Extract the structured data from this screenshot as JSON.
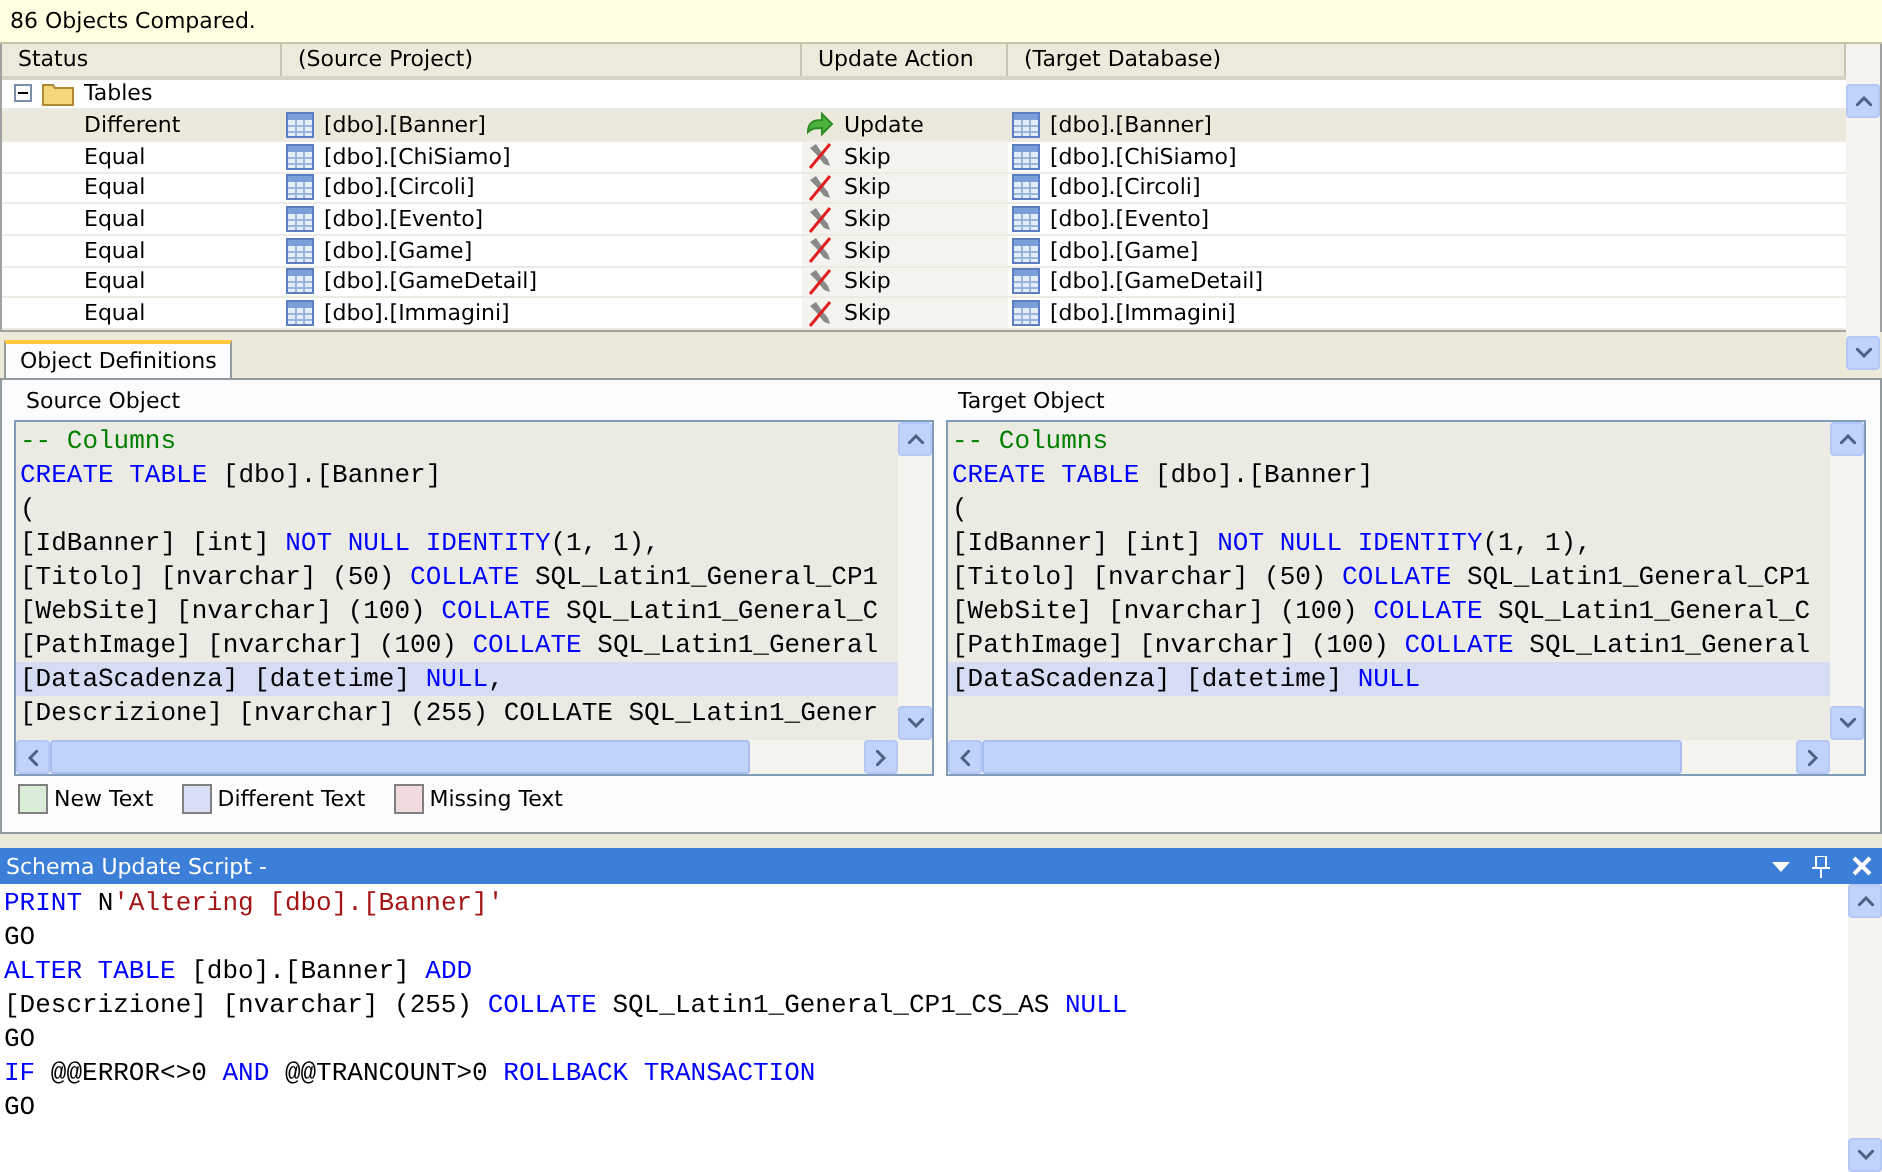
{
  "message": "86 Objects Compared.",
  "columns": [
    {
      "label": "Status"
    },
    {
      "label": "(Source Project)"
    },
    {
      "label": "Update Action"
    },
    {
      "label": "(Target Database)"
    }
  ],
  "tree": {
    "label": "Tables",
    "expanded": true,
    "children": [
      {
        "status": "Different",
        "source": "[dbo].[Banner]",
        "action": "Update",
        "kind": "update",
        "target": "[dbo].[Banner]",
        "selected": true
      },
      {
        "status": "Equal",
        "source": "[dbo].[ChiSiamo]",
        "action": "Skip",
        "kind": "skip",
        "target": "[dbo].[ChiSiamo]",
        "selected": false
      },
      {
        "status": "Equal",
        "source": "[dbo].[Circoli]",
        "action": "Skip",
        "kind": "skip",
        "target": "[dbo].[Circoli]",
        "selected": false
      },
      {
        "status": "Equal",
        "source": "[dbo].[Evento]",
        "action": "Skip",
        "kind": "skip",
        "target": "[dbo].[Evento]",
        "selected": false
      },
      {
        "status": "Equal",
        "source": "[dbo].[Game]",
        "action": "Skip",
        "kind": "skip",
        "target": "[dbo].[Game]",
        "selected": false
      },
      {
        "status": "Equal",
        "source": "[dbo].[GameDetail]",
        "action": "Skip",
        "kind": "skip",
        "target": "[dbo].[GameDetail]",
        "selected": false
      },
      {
        "status": "Equal",
        "source": "[dbo].[Immagini]",
        "action": "Skip",
        "kind": "skip",
        "target": "[dbo].[Immagini]",
        "selected": false
      }
    ]
  },
  "tab": {
    "label": "Object Definitions",
    "selected": true
  },
  "source": {
    "label": "Source Object",
    "lines": [
      {
        "changed": false,
        "segments": [
          {
            "kind": "comment",
            "text": "-- Columns"
          }
        ]
      },
      {
        "changed": false,
        "segments": [
          {
            "kind": "keyword",
            "text": "CREATE TABLE"
          },
          {
            "kind": "plain",
            "text": " [dbo].[Banner]"
          }
        ]
      },
      {
        "changed": false,
        "segments": [
          {
            "kind": "plain",
            "text": "("
          }
        ]
      },
      {
        "changed": false,
        "segments": [
          {
            "kind": "plain",
            "text": "[IdBanner] [int] "
          },
          {
            "kind": "keyword",
            "text": "NOT NULL IDENTITY"
          },
          {
            "kind": "plain",
            "text": "(1, 1),"
          }
        ]
      },
      {
        "changed": false,
        "segments": [
          {
            "kind": "plain",
            "text": "[Titolo] [nvarchar] (50) "
          },
          {
            "kind": "keyword",
            "text": "COLLATE"
          },
          {
            "kind": "plain",
            "text": " SQL_Latin1_General_CP1"
          }
        ]
      },
      {
        "changed": false,
        "segments": [
          {
            "kind": "plain",
            "text": "[WebSite] [nvarchar] (100) "
          },
          {
            "kind": "keyword",
            "text": "COLLATE"
          },
          {
            "kind": "plain",
            "text": " SQL_Latin1_General_C"
          }
        ]
      },
      {
        "changed": false,
        "segments": [
          {
            "kind": "plain",
            "text": "[PathImage] [nvarchar] (100) "
          },
          {
            "kind": "keyword",
            "text": "COLLATE"
          },
          {
            "kind": "plain",
            "text": " SQL_Latin1_General"
          }
        ]
      },
      {
        "changed": true,
        "segments": [
          {
            "kind": "plain",
            "text": "[DataScadenza] [datetime] "
          },
          {
            "kind": "keyword",
            "text": "NULL"
          },
          {
            "kind": "plain",
            "text": ","
          }
        ]
      },
      {
        "changed": false,
        "segments": [
          {
            "kind": "plain",
            "text": "[Descrizione] [nvarchar] (255) COLLATE SQL_Latin1_Gener"
          }
        ]
      }
    ]
  },
  "target": {
    "label": "Target Object",
    "lines": [
      {
        "changed": false,
        "segments": [
          {
            "kind": "comment",
            "text": "-- Columns"
          }
        ]
      },
      {
        "changed": false,
        "segments": [
          {
            "kind": "keyword",
            "text": "CREATE TABLE"
          },
          {
            "kind": "plain",
            "text": " [dbo].[Banner]"
          }
        ]
      },
      {
        "changed": false,
        "segments": [
          {
            "kind": "plain",
            "text": "("
          }
        ]
      },
      {
        "changed": false,
        "segments": [
          {
            "kind": "plain",
            "text": "[IdBanner] [int] "
          },
          {
            "kind": "keyword",
            "text": "NOT NULL IDENTITY"
          },
          {
            "kind": "plain",
            "text": "(1, 1),"
          }
        ]
      },
      {
        "changed": false,
        "segments": [
          {
            "kind": "plain",
            "text": "[Titolo] [nvarchar] (50) "
          },
          {
            "kind": "keyword",
            "text": "COLLATE"
          },
          {
            "kind": "plain",
            "text": " SQL_Latin1_General_CP1"
          }
        ]
      },
      {
        "changed": false,
        "segments": [
          {
            "kind": "plain",
            "text": "[WebSite] [nvarchar] (100) "
          },
          {
            "kind": "keyword",
            "text": "COLLATE"
          },
          {
            "kind": "plain",
            "text": " SQL_Latin1_General_C"
          }
        ]
      },
      {
        "changed": false,
        "segments": [
          {
            "kind": "plain",
            "text": "[PathImage] [nvarchar] (100) "
          },
          {
            "kind": "keyword",
            "text": "COLLATE"
          },
          {
            "kind": "plain",
            "text": " SQL_Latin1_General"
          }
        ]
      },
      {
        "changed": true,
        "segments": [
          {
            "kind": "plain",
            "text": "[DataScadenza] [datetime] "
          },
          {
            "kind": "keyword",
            "text": "NULL"
          }
        ]
      }
    ]
  },
  "legend": [
    {
      "label": "New Text",
      "color": "#d8ecd8"
    },
    {
      "label": "Different Text",
      "color": "#d8def4"
    },
    {
      "label": "Missing Text",
      "color": "#f0dcdc"
    }
  ],
  "script": {
    "title": "Schema Update Script -",
    "lines": [
      {
        "segments": [
          {
            "kind": "keyword",
            "text": "PRINT"
          },
          {
            "kind": "plain",
            "text": " N"
          },
          {
            "kind": "string",
            "text": "'Altering [dbo].[Banner]'"
          }
        ]
      },
      {
        "segments": [
          {
            "kind": "plain",
            "text": "GO"
          }
        ]
      },
      {
        "segments": [
          {
            "kind": "keyword",
            "text": "ALTER TABLE"
          },
          {
            "kind": "plain",
            "text": " [dbo].[Banner] "
          },
          {
            "kind": "keyword",
            "text": "ADD"
          }
        ]
      },
      {
        "segments": [
          {
            "kind": "plain",
            "text": "[Descrizione] [nvarchar] (255) "
          },
          {
            "kind": "keyword",
            "text": "COLLATE"
          },
          {
            "kind": "plain",
            "text": " SQL_Latin1_General_CP1_CS_AS "
          },
          {
            "kind": "keyword",
            "text": "NULL"
          }
        ]
      },
      {
        "segments": [
          {
            "kind": "plain",
            "text": "GO"
          }
        ]
      },
      {
        "segments": [
          {
            "kind": "keyword",
            "text": "IF"
          },
          {
            "kind": "plain",
            "text": " @@ERROR<>0 "
          },
          {
            "kind": "keyword",
            "text": "AND"
          },
          {
            "kind": "plain",
            "text": " @@TRANCOUNT>0 "
          },
          {
            "kind": "keyword",
            "text": "ROLLBACK TRANSACTION"
          }
        ]
      },
      {
        "segments": [
          {
            "kind": "plain",
            "text": "GO"
          }
        ]
      }
    ]
  }
}
